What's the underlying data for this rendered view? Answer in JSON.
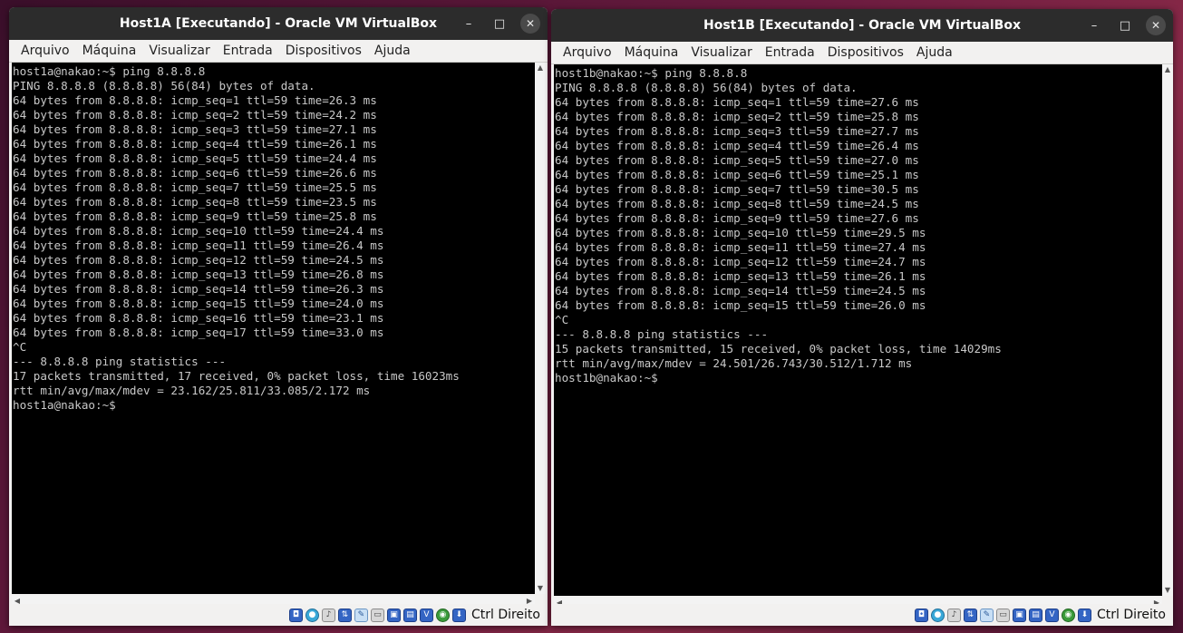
{
  "window_a": {
    "title": "Host1A [Executando] - Oracle VM VirtualBox",
    "controls": {
      "minimize": "–",
      "maximize": "□",
      "close": "✕"
    },
    "menu": [
      "Arquivo",
      "Máquina",
      "Visualizar",
      "Entrada",
      "Dispositivos",
      "Ajuda"
    ],
    "terminal_lines": [
      "host1a@nakao:~$ ping 8.8.8.8",
      "PING 8.8.8.8 (8.8.8.8) 56(84) bytes of data.",
      "64 bytes from 8.8.8.8: icmp_seq=1 ttl=59 time=26.3 ms",
      "64 bytes from 8.8.8.8: icmp_seq=2 ttl=59 time=24.2 ms",
      "64 bytes from 8.8.8.8: icmp_seq=3 ttl=59 time=27.1 ms",
      "64 bytes from 8.8.8.8: icmp_seq=4 ttl=59 time=26.1 ms",
      "64 bytes from 8.8.8.8: icmp_seq=5 ttl=59 time=24.4 ms",
      "64 bytes from 8.8.8.8: icmp_seq=6 ttl=59 time=26.6 ms",
      "64 bytes from 8.8.8.8: icmp_seq=7 ttl=59 time=25.5 ms",
      "64 bytes from 8.8.8.8: icmp_seq=8 ttl=59 time=23.5 ms",
      "64 bytes from 8.8.8.8: icmp_seq=9 ttl=59 time=25.8 ms",
      "64 bytes from 8.8.8.8: icmp_seq=10 ttl=59 time=24.4 ms",
      "64 bytes from 8.8.8.8: icmp_seq=11 ttl=59 time=26.4 ms",
      "64 bytes from 8.8.8.8: icmp_seq=12 ttl=59 time=24.5 ms",
      "64 bytes from 8.8.8.8: icmp_seq=13 ttl=59 time=26.8 ms",
      "64 bytes from 8.8.8.8: icmp_seq=14 ttl=59 time=26.3 ms",
      "64 bytes from 8.8.8.8: icmp_seq=15 ttl=59 time=24.0 ms",
      "64 bytes from 8.8.8.8: icmp_seq=16 ttl=59 time=23.1 ms",
      "64 bytes from 8.8.8.8: icmp_seq=17 ttl=59 time=33.0 ms",
      "^C",
      "--- 8.8.8.8 ping statistics ---",
      "17 packets transmitted, 17 received, 0% packet loss, time 16023ms",
      "rtt min/avg/max/mdev = 23.162/25.811/33.085/2.172 ms",
      "host1a@nakao:~$"
    ],
    "host_key": "Ctrl Direito"
  },
  "window_b": {
    "title": "Host1B [Executando] - Oracle VM VirtualBox",
    "controls": {
      "minimize": "–",
      "maximize": "□",
      "close": "✕"
    },
    "menu": [
      "Arquivo",
      "Máquina",
      "Visualizar",
      "Entrada",
      "Dispositivos",
      "Ajuda"
    ],
    "terminal_lines": [
      "host1b@nakao:~$ ping 8.8.8.8",
      "PING 8.8.8.8 (8.8.8.8) 56(84) bytes of data.",
      "64 bytes from 8.8.8.8: icmp_seq=1 ttl=59 time=27.6 ms",
      "64 bytes from 8.8.8.8: icmp_seq=2 ttl=59 time=25.8 ms",
      "64 bytes from 8.8.8.8: icmp_seq=3 ttl=59 time=27.7 ms",
      "64 bytes from 8.8.8.8: icmp_seq=4 ttl=59 time=26.4 ms",
      "64 bytes from 8.8.8.8: icmp_seq=5 ttl=59 time=27.0 ms",
      "64 bytes from 8.8.8.8: icmp_seq=6 ttl=59 time=25.1 ms",
      "64 bytes from 8.8.8.8: icmp_seq=7 ttl=59 time=30.5 ms",
      "64 bytes from 8.8.8.8: icmp_seq=8 ttl=59 time=24.5 ms",
      "64 bytes from 8.8.8.8: icmp_seq=9 ttl=59 time=27.6 ms",
      "64 bytes from 8.8.8.8: icmp_seq=10 ttl=59 time=29.5 ms",
      "64 bytes from 8.8.8.8: icmp_seq=11 ttl=59 time=27.4 ms",
      "64 bytes from 8.8.8.8: icmp_seq=12 ttl=59 time=24.7 ms",
      "64 bytes from 8.8.8.8: icmp_seq=13 ttl=59 time=26.1 ms",
      "64 bytes from 8.8.8.8: icmp_seq=14 ttl=59 time=24.5 ms",
      "64 bytes from 8.8.8.8: icmp_seq=15 ttl=59 time=26.0 ms",
      "^C",
      "--- 8.8.8.8 ping statistics ---",
      "15 packets transmitted, 15 received, 0% packet loss, time 14029ms",
      "rtt min/avg/max/mdev = 24.501/26.743/30.512/1.712 ms",
      "host1b@nakao:~$"
    ],
    "host_key": "Ctrl Direito"
  },
  "status_icons": [
    "hard-disk-icon",
    "optical-drive-icon",
    "audio-icon",
    "network-icon",
    "usb-icon",
    "shared-folders-icon",
    "display-icon",
    "video-capture-icon",
    "cpu-icon",
    "mouse-integration-icon",
    "keyboard-capture-icon"
  ],
  "colors": {
    "terminal_bg": "#000000",
    "terminal_fg": "#c8c8c8",
    "titlebar_bg": "#2c2c2c",
    "chrome_bg": "#f2f1f0"
  }
}
